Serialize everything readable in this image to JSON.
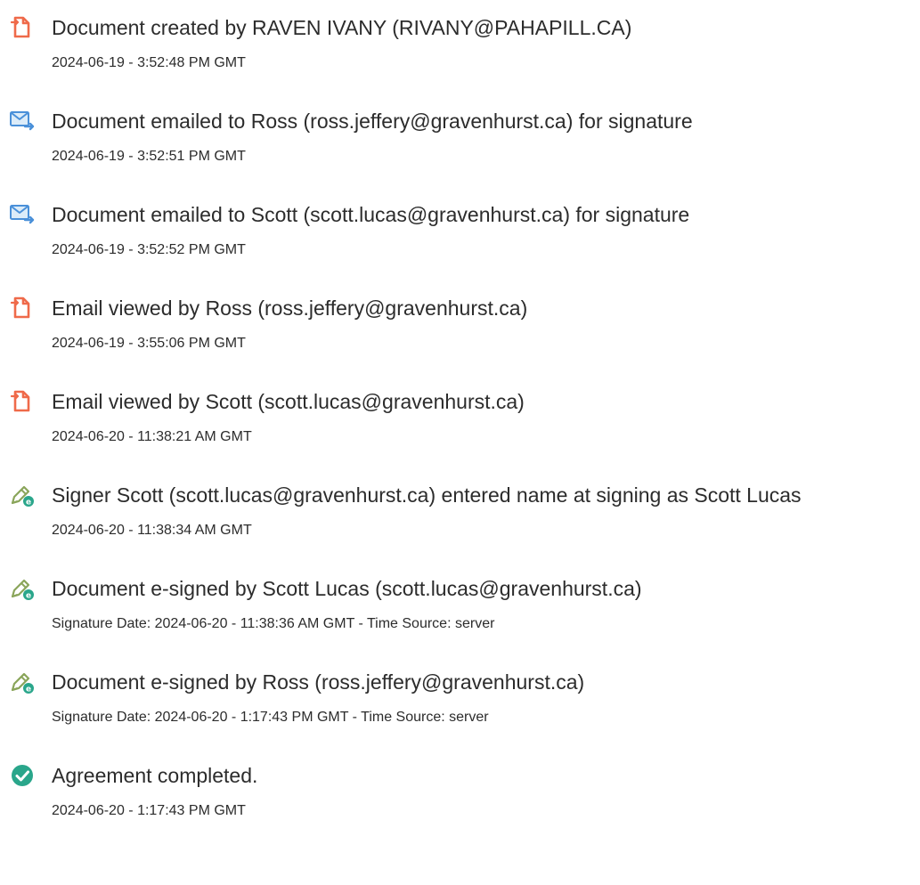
{
  "events": [
    {
      "icon": "document-icon",
      "title": "Document created by RAVEN IVANY (RIVANY@PAHAPILL.CA)",
      "subtitle": "2024-06-19 - 3:52:48 PM GMT"
    },
    {
      "icon": "email-sent-icon",
      "title": "Document emailed to Ross (ross.jeffery@gravenhurst.ca) for signature",
      "subtitle": "2024-06-19 - 3:52:51 PM GMT"
    },
    {
      "icon": "email-sent-icon",
      "title": "Document emailed to Scott (scott.lucas@gravenhurst.ca) for signature",
      "subtitle": "2024-06-19 - 3:52:52 PM GMT"
    },
    {
      "icon": "document-icon",
      "title": "Email viewed by Ross (ross.jeffery@gravenhurst.ca)",
      "subtitle": "2024-06-19 - 3:55:06 PM GMT"
    },
    {
      "icon": "document-icon",
      "title": "Email viewed by Scott (scott.lucas@gravenhurst.ca)",
      "subtitle": "2024-06-20 - 11:38:21 AM GMT"
    },
    {
      "icon": "e-sign-pen-icon",
      "title": "Signer Scott (scott.lucas@gravenhurst.ca) entered name at signing as Scott Lucas",
      "subtitle": "2024-06-20 - 11:38:34 AM GMT"
    },
    {
      "icon": "e-sign-pen-icon",
      "title": "Document e-signed by Scott Lucas (scott.lucas@gravenhurst.ca)",
      "subtitle": "Signature Date: 2024-06-20 - 11:38:36 AM GMT - Time Source: server"
    },
    {
      "icon": "e-sign-pen-icon",
      "title": "Document e-signed by Ross (ross.jeffery@gravenhurst.ca)",
      "subtitle": "Signature Date: 2024-06-20 - 1:17:43 PM GMT - Time Source: server"
    },
    {
      "icon": "check-circle-icon",
      "title": "Agreement completed.",
      "subtitle": "2024-06-20 - 1:17:43 PM GMT"
    }
  ],
  "colors": {
    "document_icon": "#ef6a4a",
    "email_icon": "#4a90d9",
    "pen_icon": "#8aa55a",
    "pen_badge": "#2aa68b",
    "check_icon": "#2aa68b",
    "text": "#2c2c2c"
  }
}
